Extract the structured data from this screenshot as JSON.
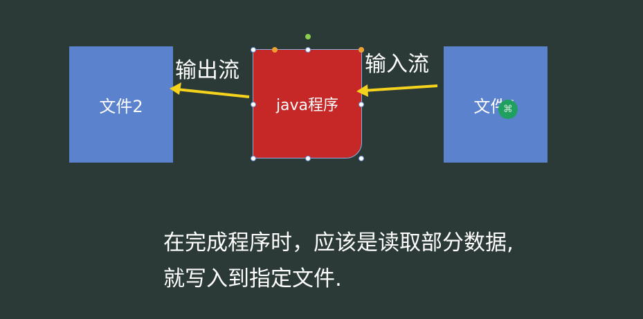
{
  "diagram": {
    "file2_label": "文件2",
    "file1_label": "文件1",
    "program_label": "java程序",
    "output_label": "输出流",
    "input_label": "输入流",
    "arrow_color": "#f5d31c",
    "file_color": "#5b82cc",
    "program_color": "#c62828"
  },
  "caption": {
    "line1": "在完成程序时，应该是读取部分数据,",
    "line2": "就写入到指定文件."
  },
  "cursor": {
    "icon": "move-cursor-icon",
    "glyph": "⌘"
  }
}
